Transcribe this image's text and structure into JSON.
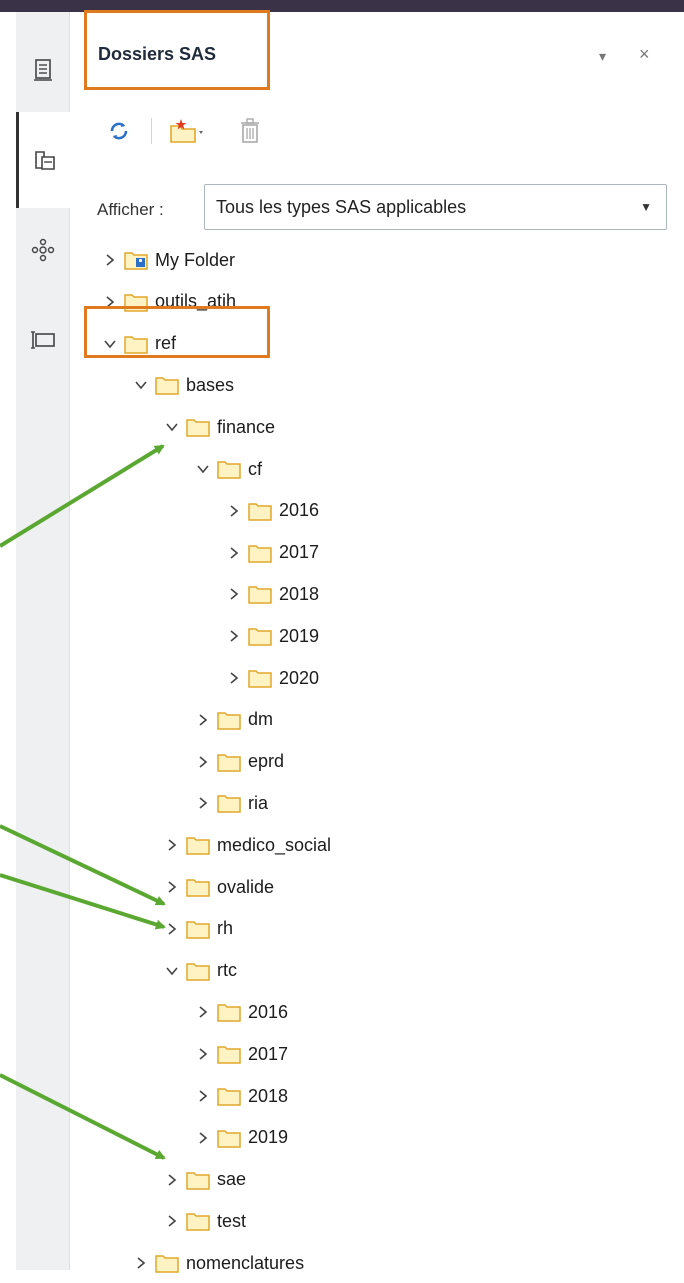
{
  "panel": {
    "title": "Dossiers SAS",
    "menu_glyph": "▾",
    "close_glyph": "×"
  },
  "toolbar": {
    "refresh_icon": "refresh-icon",
    "new_folder_icon": "new-folder-icon",
    "delete_icon": "trash-icon"
  },
  "filter": {
    "label": "Afficher :",
    "selected": "Tous les types SAS applicables"
  },
  "tree": [
    {
      "label": "My Folder",
      "level": 0,
      "expanded": false,
      "special": true
    },
    {
      "label": "outils_atih",
      "level": 0,
      "expanded": false
    },
    {
      "label": "ref",
      "level": 0,
      "expanded": true
    },
    {
      "label": "bases",
      "level": 1,
      "expanded": true
    },
    {
      "label": "finance",
      "level": 2,
      "expanded": true
    },
    {
      "label": "cf",
      "level": 3,
      "expanded": true
    },
    {
      "label": "2016",
      "level": 4,
      "expanded": false
    },
    {
      "label": "2017",
      "level": 4,
      "expanded": false
    },
    {
      "label": "2018",
      "level": 4,
      "expanded": false
    },
    {
      "label": "2019",
      "level": 4,
      "expanded": false
    },
    {
      "label": "2020",
      "level": 4,
      "expanded": false
    },
    {
      "label": "dm",
      "level": 3,
      "expanded": false
    },
    {
      "label": "eprd",
      "level": 3,
      "expanded": false
    },
    {
      "label": "ria",
      "level": 3,
      "expanded": false
    },
    {
      "label": "medico_social",
      "level": 2,
      "expanded": false
    },
    {
      "label": "ovalide",
      "level": 2,
      "expanded": false
    },
    {
      "label": "rh",
      "level": 2,
      "expanded": false
    },
    {
      "label": "rtc",
      "level": 2,
      "expanded": true
    },
    {
      "label": "2016",
      "level": 3,
      "expanded": false
    },
    {
      "label": "2017",
      "level": 3,
      "expanded": false
    },
    {
      "label": "2018",
      "level": 3,
      "expanded": false
    },
    {
      "label": "2019",
      "level": 3,
      "expanded": false
    },
    {
      "label": "sae",
      "level": 2,
      "expanded": false
    },
    {
      "label": "test",
      "level": 2,
      "expanded": false
    },
    {
      "label": "nomenclatures",
      "level": 1,
      "expanded": false
    }
  ],
  "sidebar_icons": [
    "server-icon",
    "folders-icon",
    "network-icon",
    "snippets-icon"
  ],
  "colors": {
    "highlight": "#e07a1f",
    "arrow": "#5aa832",
    "folder_fill": "#fff3c4",
    "folder_stroke": "#e0a72c"
  }
}
